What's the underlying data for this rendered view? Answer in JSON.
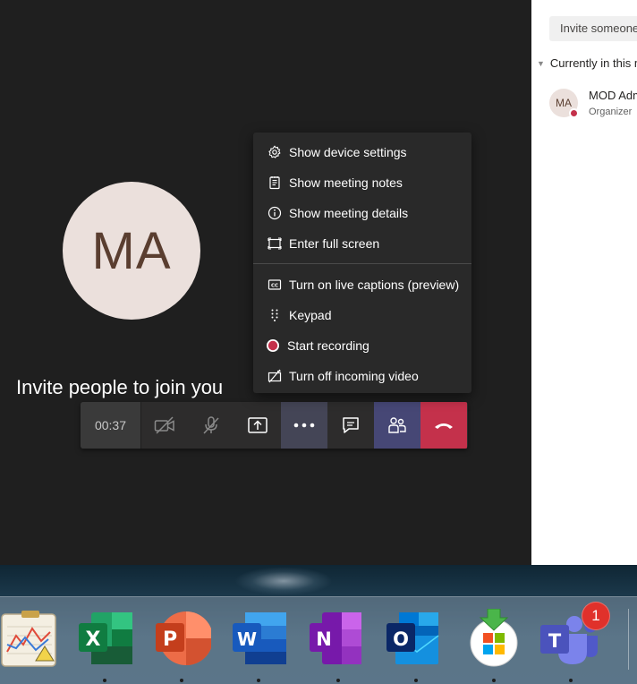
{
  "stage": {
    "avatar_initials": "MA",
    "invite_message": "Invite people to join you"
  },
  "toolbar": {
    "timer": "00:37"
  },
  "menu": {
    "group1": [
      {
        "label": "Show device settings",
        "icon": "gear-icon"
      },
      {
        "label": "Show meeting notes",
        "icon": "notes-icon"
      },
      {
        "label": "Show meeting details",
        "icon": "info-icon"
      },
      {
        "label": "Enter full screen",
        "icon": "fullscreen-icon"
      }
    ],
    "group2": [
      {
        "label": "Turn on live captions (preview)",
        "icon": "cc-icon"
      },
      {
        "label": "Keypad",
        "icon": "keypad-icon"
      },
      {
        "label": "Start recording",
        "icon": "record-icon"
      },
      {
        "label": "Turn off incoming video",
        "icon": "video-off-icon"
      }
    ]
  },
  "panel": {
    "invite_text": "Invite someone",
    "section_title": "Currently in this meeting",
    "participants": [
      {
        "initials": "MA",
        "name": "MOD Administrator",
        "role": "Organizer"
      }
    ]
  },
  "dock": {
    "teams_badge": "1",
    "apps": [
      "Grapher",
      "Excel",
      "PowerPoint",
      "Word",
      "OneNote",
      "Outlook",
      "Microsoft AutoUpdate",
      "Teams"
    ]
  },
  "colors": {
    "stage_bg": "#1f1f1f",
    "menu_bg": "#292929",
    "hangup": "#c4314b",
    "participants_active": "#464775",
    "record_red": "#c4314b"
  }
}
